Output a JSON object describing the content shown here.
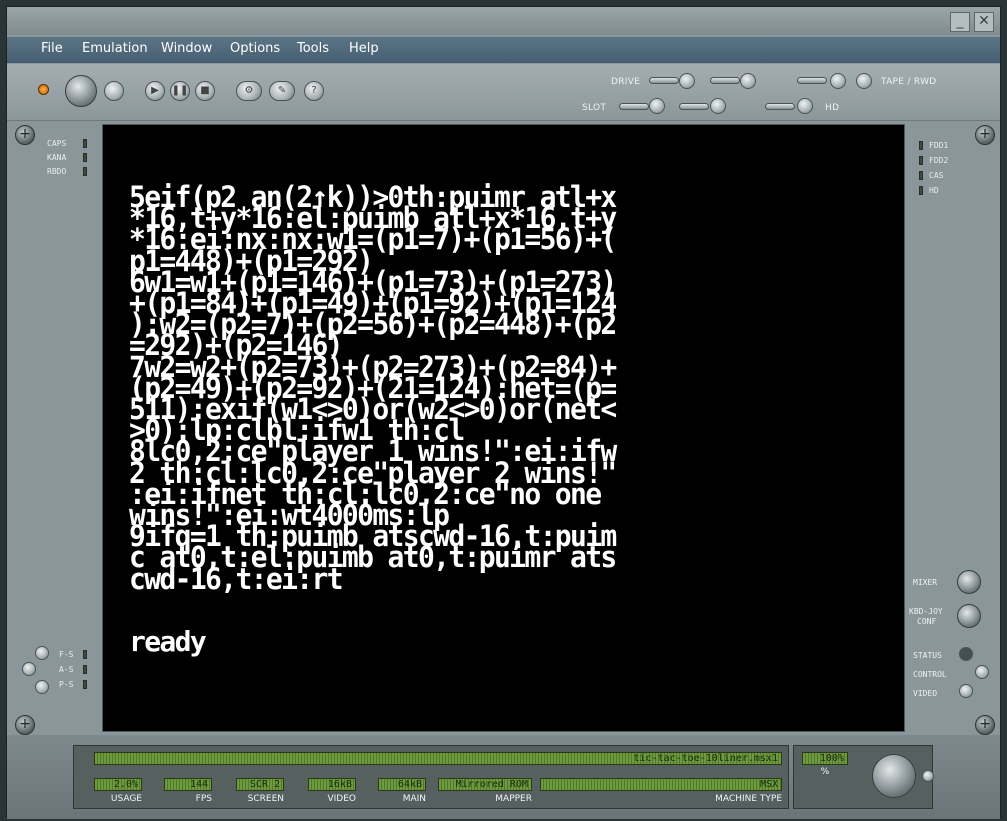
{
  "menu": [
    "File",
    "Emulation",
    "Window",
    "Options",
    "Tools",
    "Help"
  ],
  "toolbar_labels": {
    "drive": "DRIVE",
    "slot": "SLOT",
    "tape": "TAPE / RWD",
    "hd": "HD"
  },
  "left_leds": [
    "CAPS",
    "KANA",
    "RBDO"
  ],
  "right_leds": [
    "FDD1",
    "FDD2",
    "CAS",
    "HD"
  ],
  "left_bottom_leds": [
    "F-S",
    "A-S",
    "P-S"
  ],
  "right_controls": {
    "mixer": "MIXER",
    "kbd_joy": "KBD-JOY",
    "conf": "CONF",
    "status": "STATUS",
    "control": "CONTROL",
    "video": "VIDEO"
  },
  "screen": {
    "lines": [
      "5eif(p2 an(2↑k))>0th:puimr atl+x",
      "*16,t+y*16:el:puimb atl+x*16,t+y",
      "*16:ei:nx:nx:w1=(p1=7)+(p1=56)+(",
      "p1=448)+(p1=292)",
      "6w1=w1+(p1=146)+(p1=73)+(p1=273)",
      "+(p1=84)+(p1=49)+(p1=92)+(p1=124",
      "):w2=(p2=7)+(p2=56)+(p2=448)+(p2",
      "=292)+(p2=146)",
      "7w2=w2+(p2=73)+(p2=273)+(p2=84)+",
      "(p2=49)+(p2=92)+(21=124):net=(p=",
      "511):exif(w1<>0)or(w2<>0)or(net<",
      ">0):lp:clbl:ifw1 th:cl",
      "8lc0,2:ce\"player 1 wins!\":ei:ifw",
      "2 th:cl:lc0,2:ce\"player 2 wins!\"",
      ":ei:ifnet th:cl:lc0,2:ce\"no one",
      "wins!\":ei:wt4000ms:lp",
      "9ifq=1 th:puimb atscwd-16,t:puim",
      "c at0,t:el:puimb at0,t:puimr ats",
      "cwd-16,t:ei:rt"
    ],
    "ready": "ready"
  },
  "status": {
    "filename": "tic-tac-toe-10liner.msx1",
    "speed": "100%",
    "speed_unit": "%",
    "usage": {
      "value": "2.0%",
      "label": "USAGE"
    },
    "fps": {
      "value": "144",
      "label": "FPS"
    },
    "screen": {
      "value": "SCR 2",
      "label": "SCREEN"
    },
    "video": {
      "value": "16kB",
      "label": "VIDEO"
    },
    "main": {
      "value": "64kB",
      "label": "MAIN"
    },
    "mapper": {
      "value": "Mirrored ROM",
      "label": "MAPPER"
    },
    "machine": {
      "value": "MSX",
      "label": "MACHINE TYPE"
    }
  }
}
